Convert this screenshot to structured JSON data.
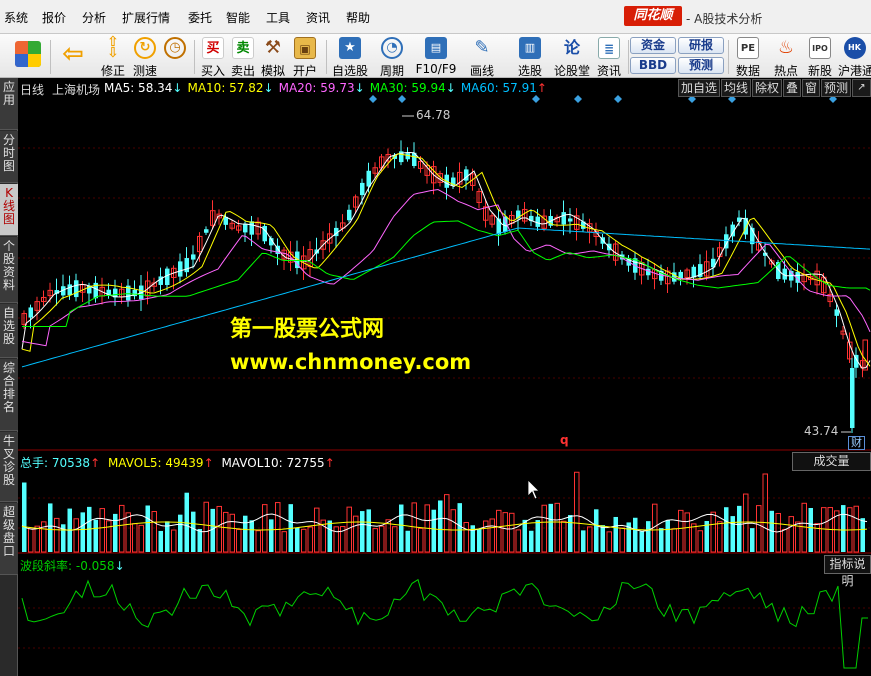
{
  "menu": [
    "系统",
    "报价",
    "分析",
    "扩展行情",
    "委托",
    "智能",
    "工具",
    "资讯",
    "帮助"
  ],
  "brand": {
    "logo": "同花顺",
    "title": "- A股技术分析"
  },
  "toolbar": [
    {
      "label": "",
      "icon": "windows-grid-icon"
    },
    {
      "label": "",
      "icon": "back-arrow-icon"
    },
    {
      "label": "修正",
      "icon": "up-down-arrows-icon"
    },
    {
      "label": "测速",
      "icon": "refresh-icon"
    },
    {
      "label": "",
      "icon": "clock-icon"
    },
    {
      "label": "买入",
      "icon": "buy-icon",
      "glyph": "买"
    },
    {
      "label": "卖出",
      "icon": "sell-icon",
      "glyph": "卖"
    },
    {
      "label": "模拟",
      "icon": "hammer-icon"
    },
    {
      "label": "开户",
      "icon": "lock-icon"
    },
    {
      "label": "自选股",
      "icon": "star-folder-icon"
    },
    {
      "label": "周期",
      "icon": "clock-cycle-icon"
    },
    {
      "label": "F10/F9",
      "icon": "f10-icon"
    },
    {
      "label": "画线",
      "icon": "pen-icon"
    },
    {
      "label": "选股",
      "icon": "chart-select-icon"
    },
    {
      "label": "论股堂",
      "icon": "lun-icon",
      "glyph": "论"
    },
    {
      "label": "资讯",
      "icon": "document-icon"
    },
    {
      "label": "数据",
      "icon": "pe-icon",
      "glyph": "PE"
    },
    {
      "label": "热点",
      "icon": "fire-icon"
    },
    {
      "label": "新股",
      "icon": "ipo-icon",
      "glyph": "IPO"
    },
    {
      "label": "沪港通",
      "icon": "sse-hk-icon"
    }
  ],
  "pills": [
    "资金",
    "BBD",
    "研报",
    "预测"
  ],
  "left_tabs": [
    "应用",
    "分时图",
    "K线图",
    "个股资料",
    "自选股",
    "综合排名",
    "牛叉诊股",
    "超级盘口"
  ],
  "price_panel": {
    "period": "日线",
    "stock_name": "上海机场",
    "ma": [
      {
        "name": "MA5",
        "value": "58.34",
        "arrow": "↓",
        "color": "#ffffff"
      },
      {
        "name": "MA10",
        "value": "57.82",
        "arrow": "↓",
        "color": "#ffff00"
      },
      {
        "name": "MA20",
        "value": "59.73",
        "arrow": "↓",
        "color": "#ff66ff"
      },
      {
        "name": "MA30",
        "value": "59.94",
        "arrow": "↓",
        "color": "#00ff00"
      },
      {
        "name": "MA60",
        "value": "57.91",
        "arrow": "↑",
        "color": "#00bfff"
      }
    ],
    "buttons": [
      "加自选",
      "均线",
      "除权",
      "叠",
      "窗",
      "预测"
    ],
    "high_label": "64.78",
    "low_label": "43.74",
    "cai_badge": "财",
    "q_marker": "q"
  },
  "volume_panel": {
    "title": "总手",
    "title_value": "70538",
    "mavol5": "49439",
    "mavol10": "72755",
    "button": "成交量"
  },
  "indicator_panel": {
    "name": "波段斜率",
    "value": "-0.058",
    "button": "指标说明"
  },
  "watermark": {
    "line1": "第一股票公式网",
    "line2": "www.chnmoney.com"
  },
  "colors": {
    "up": "#ff3232",
    "down": "#54ffff",
    "indicator": "#00d000",
    "bg": "#000000"
  }
}
